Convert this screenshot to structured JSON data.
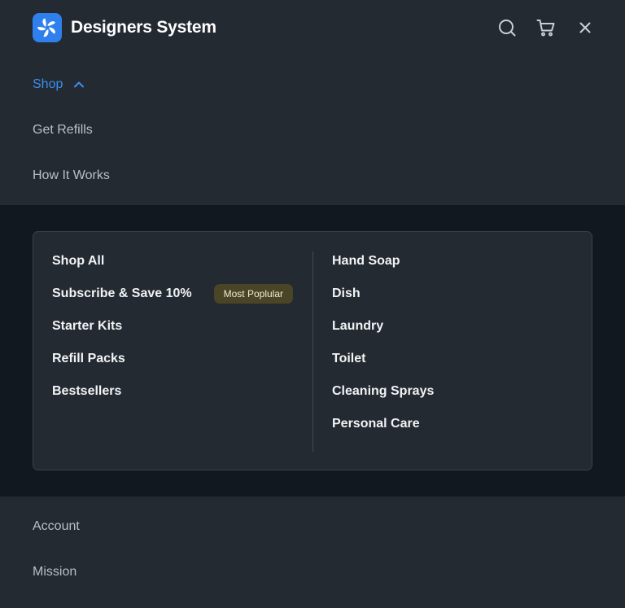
{
  "header": {
    "brand": "Designers System",
    "icons": [
      "logo-icon",
      "search-icon",
      "cart-icon",
      "close-icon"
    ]
  },
  "nav": {
    "top_items": [
      {
        "label": "Shop",
        "expanded": true
      },
      {
        "label": "Get Refills"
      },
      {
        "label": "How It Works"
      }
    ],
    "bottom_items": [
      {
        "label": "Account"
      },
      {
        "label": "Mission"
      }
    ]
  },
  "dropdown": {
    "left": [
      {
        "label": "Shop All"
      },
      {
        "label": "Subscribe & Save 10%",
        "badge": "Most Poplular"
      },
      {
        "label": "Starter Kits"
      },
      {
        "label": "Refill Packs"
      },
      {
        "label": "Bestsellers"
      }
    ],
    "right": [
      {
        "label": "Hand Soap"
      },
      {
        "label": "Dish"
      },
      {
        "label": "Laundry"
      },
      {
        "label": "Toilet"
      },
      {
        "label": "Cleaning Sprays"
      },
      {
        "label": "Personal Care"
      }
    ]
  },
  "colors": {
    "background": "#242a31",
    "dropdown_band": "#111820",
    "accent": "#3b8ef0",
    "badge_bg": "#4a4526"
  }
}
